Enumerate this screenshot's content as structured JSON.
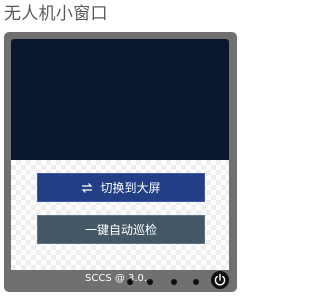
{
  "window": {
    "title": "无人机小窗口"
  },
  "buttons": {
    "switch_label": "切换到大屏",
    "switch_icon": "swap-arrows-icon",
    "patrol_label": "一键自动巡检"
  },
  "footer": {
    "text": "SCCS @ 3.0.",
    "dots_count_label": "",
    "power_icon": "power-icon"
  },
  "colors": {
    "video_bg": "#0a162c",
    "frame": "#707070",
    "switch_button": "#223f86",
    "patrol_button": "#435767"
  }
}
